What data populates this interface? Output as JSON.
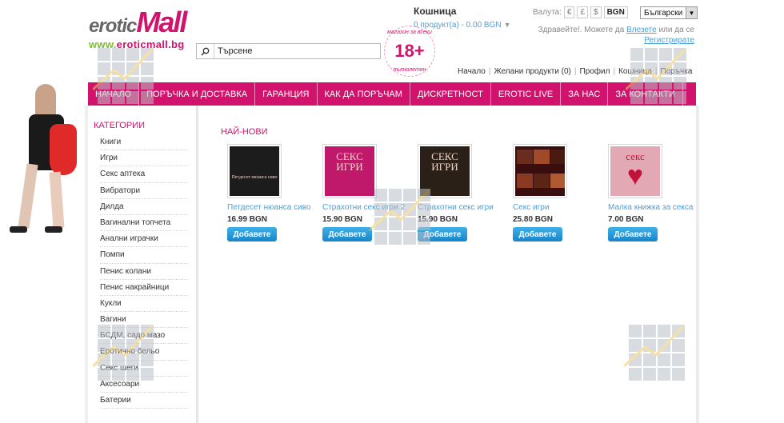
{
  "header": {
    "logo": {
      "word1": "erotic",
      "word2": "Mall",
      "url_w": "www.",
      "url_rest": "eroticmall.bg"
    },
    "search": {
      "placeholder": "Търсене",
      "value": "Търсене"
    },
    "badge": {
      "number": "18+",
      "top_text": "магазин за всеки",
      "bottom_text": "пълнолетен"
    },
    "cart": {
      "title": "Кошница",
      "summary": "0 продукт(а) - 0.00 BGN"
    },
    "currency": {
      "label": "Валута:",
      "options": [
        "€",
        "£",
        "$",
        "BGN"
      ],
      "selected": "BGN"
    },
    "language": {
      "selected": "Български"
    },
    "welcome": {
      "text": "Здравейте!. Можете да ",
      "login": "Влезете",
      "middle": " или да се ",
      "register": "Регистрирате"
    },
    "top_links": [
      "Начало",
      "Желани продукти (0)",
      "Профил",
      "Кошница",
      "Поръчка"
    ]
  },
  "nav": [
    "НАЧАЛО",
    "ПОРЪЧКА И ДОСТАВКА",
    "ГАРАНЦИЯ",
    "КАК ДА ПОРЪЧАМ",
    "ДИСКРЕТНОСТ",
    "EROTIC LIVE",
    "ЗА НАС",
    "ЗА КОНТАКТИ"
  ],
  "sidebar": {
    "title": "Категории",
    "items": [
      "Книги",
      "Игри",
      "Секс аптека",
      "Вибратори",
      "Дилда",
      "Вагинални топчета",
      "Анални играчки",
      "Помпи",
      "Пенис колани",
      "Пенис накрайници",
      "Кукли",
      "Вагини",
      "БСДМ, садо мазо",
      "Еротично бельо",
      "Секс шеги",
      "Аксесоари",
      "Батерии"
    ]
  },
  "main": {
    "title": "НАЙ-НОВИ",
    "products": [
      {
        "name": "Петдесет нюанса сиво",
        "price": "16.99 BGN",
        "button": "Добавете",
        "cover_color": "#1c1c1c",
        "cover_text": "Петдесет нюанса сиво"
      },
      {
        "name": "Страхотни секс игри 2",
        "price": "15.90 BGN",
        "button": "Добавете",
        "cover_color": "#c0186a",
        "cover_text": "СЕКС ИГРИ"
      },
      {
        "name": "Страхотни секс игри",
        "price": "15.90 BGN",
        "button": "Добавете",
        "cover_color": "#2a2018",
        "cover_text": "СЕКС ИГРИ"
      },
      {
        "name": "Секс игри",
        "price": "25.80 BGN",
        "button": "Добавете",
        "cover_color": "#3a0e0e",
        "cover_text": ""
      },
      {
        "name": "Малка книжка за секса",
        "price": "7.00 BGN",
        "button": "Добавете",
        "cover_color": "#e2a9b4",
        "cover_text": "секс"
      }
    ]
  },
  "colors": {
    "accent": "#d2136e",
    "link": "#4a9fd8",
    "button": "#2a9bdc"
  }
}
